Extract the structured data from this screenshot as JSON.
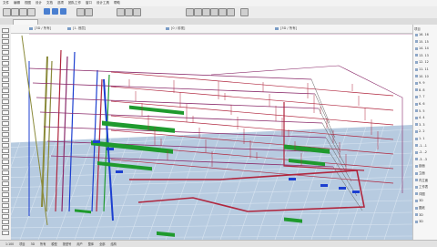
{
  "menu": {
    "items": [
      "文件",
      "编辑",
      "视图",
      "设计",
      "文档",
      "选项",
      "团队工作",
      "窗口",
      "设计工具",
      "帮助"
    ]
  },
  "viewport": {
    "tabs": [
      "[3D / 所有]",
      "[1. 首层]",
      "[0 / 前视]",
      "[3D / 所有]"
    ],
    "scene": "3D MEP pipe network view",
    "floor_color": "#b7cbe0",
    "pipe_colors": {
      "red": "#b0263e",
      "green": "#1f9a2e",
      "blue": "#1c3fd0",
      "magenta": "#8a2a6a",
      "gray": "#606060",
      "olive": "#8a8a3a"
    }
  },
  "navigator": {
    "title": "项目",
    "items": [
      "16. 16",
      "15. 15",
      "14. 14",
      "13. 13",
      "12. 12",
      "11. 11",
      "10. 10",
      "9. 9",
      "8. 8",
      "7. 7",
      "6. 6",
      "5. 5",
      "4. 4",
      "3. 3",
      "2. 2",
      "1. 1",
      "-1. -1",
      "-2. -2",
      "-3. -3",
      "剖面",
      "立面",
      "内立面",
      "工作表",
      "详图",
      "3D",
      "图纸",
      "3D",
      "3D"
    ]
  },
  "statusbar": {
    "items": [
      "1:100",
      "项目",
      "3D",
      "所有",
      "模型",
      "按型号",
      "用户",
      "整体",
      "全部",
      "结构"
    ]
  }
}
